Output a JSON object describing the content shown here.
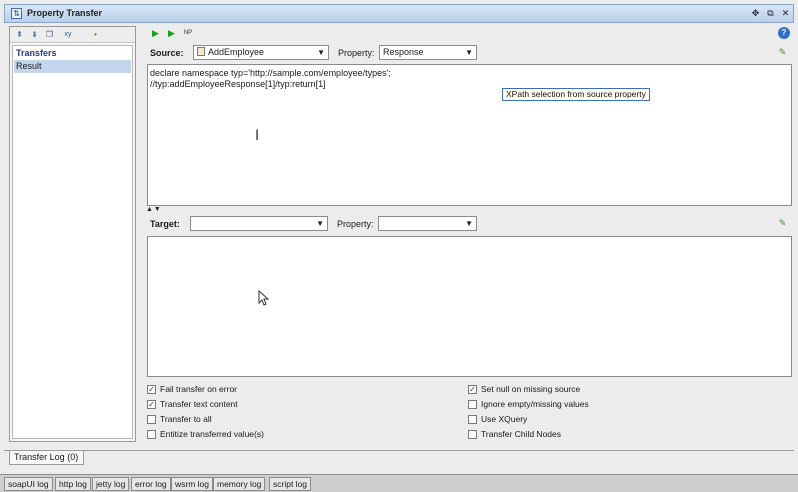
{
  "window": {
    "title": "Property Transfer"
  },
  "left": {
    "header": "Transfers",
    "items": [
      "Result"
    ],
    "toolbar_icons": [
      "add-transfer-icon",
      "copy-transfer-icon",
      "clone-icon",
      "rename-icon",
      "status-dot-icon"
    ],
    "rename_label": "xy"
  },
  "toolbar": {
    "icons": [
      "run-icon",
      "run-all-icon",
      "options-icon"
    ],
    "np_label": "NP"
  },
  "source": {
    "label": "Source:",
    "step_value": "AddEmployee",
    "property_label": "Property:",
    "property_value": "Response",
    "xpath_line1": "declare namespace typ='http://sample.com/employee/types';",
    "xpath_line2": "//typ:addEmployeeResponse[1]/typ:return[1]",
    "tooltip": "XPath selection from source property"
  },
  "target": {
    "label": "Target:",
    "step_value": "",
    "property_label": "Property:",
    "property_value": "",
    "xpath": ""
  },
  "options": [
    {
      "label": "Fail transfer on error",
      "checked": true
    },
    {
      "label": "Transfer text content",
      "checked": true
    },
    {
      "label": "Transfer to all",
      "checked": false
    },
    {
      "label": "Entitize transferred value(s)",
      "checked": false
    },
    {
      "label": "Set null on missing source",
      "checked": true
    },
    {
      "label": "Ignore empty/missing values",
      "checked": false
    },
    {
      "label": "Use XQuery",
      "checked": false
    },
    {
      "label": "Transfer Child Nodes",
      "checked": false
    }
  ],
  "transfer_log_tab": "Transfer Log (0)",
  "log_tabs": [
    "soapUI log",
    "http log",
    "jetty log",
    "error log",
    "wsrm log",
    "memory log",
    "script log"
  ]
}
